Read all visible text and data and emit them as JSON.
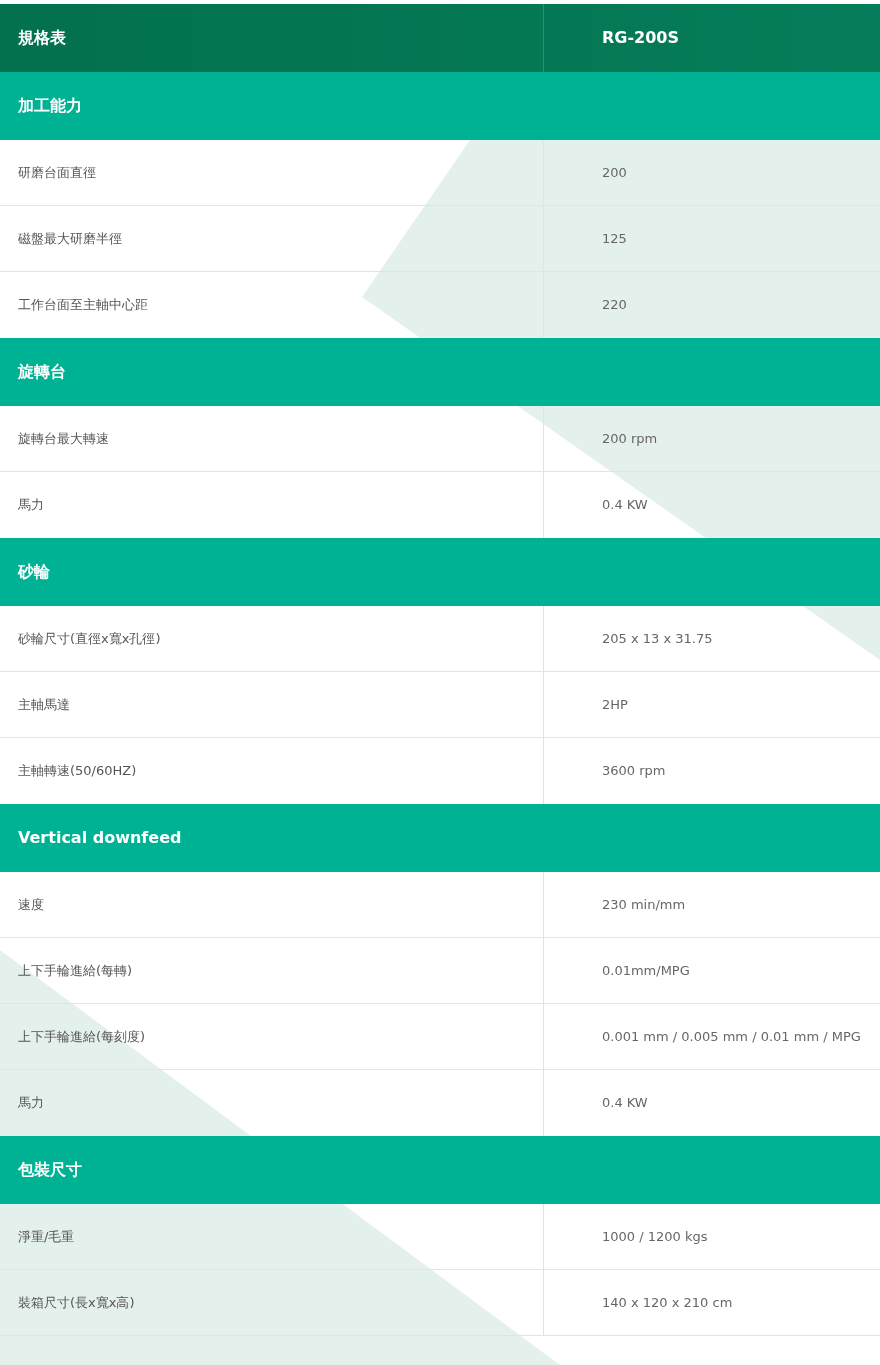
{
  "header": {
    "label": "規格表",
    "model": "RG-200S"
  },
  "sections": [
    {
      "title": "加工能力",
      "rows": [
        {
          "label": "研磨台面直徑",
          "value": "200"
        },
        {
          "label": "磁盤最大研磨半徑",
          "value": "125"
        },
        {
          "label": "工作台面至主軸中心距",
          "value": "220"
        }
      ]
    },
    {
      "title": "旋轉台",
      "rows": [
        {
          "label": "旋轉台最大轉速",
          "value": "200 rpm"
        },
        {
          "label": "馬力",
          "value": "0.4 KW"
        }
      ]
    },
    {
      "title": "砂輪",
      "rows": [
        {
          "label": "砂輪尺寸(直徑x寬x孔徑)",
          "value": "205 x 13 x 31.75"
        },
        {
          "label": "主軸馬達",
          "value": "2HP"
        },
        {
          "label": "主軸轉速(50/60HZ)",
          "value": "3600 rpm"
        }
      ]
    },
    {
      "title": "Vertical downfeed",
      "rows": [
        {
          "label": "速度",
          "value": "230 min/mm"
        },
        {
          "label": "上下手輪進給(每轉)",
          "value": "0.01mm/MPG"
        },
        {
          "label": "上下手輪進給(每刻度)",
          "value": "0.001 mm / 0.005 mm / 0.01 mm / MPG"
        },
        {
          "label": "馬力",
          "value": "0.4 KW"
        }
      ]
    },
    {
      "title": "包裝尺寸",
      "rows": [
        {
          "label": "淨重/毛重",
          "value": "1000 / 1200 kgs"
        },
        {
          "label": "裝箱尺寸(長x寬x高)",
          "value": "140 x 120 x 210 cm"
        }
      ]
    }
  ]
}
